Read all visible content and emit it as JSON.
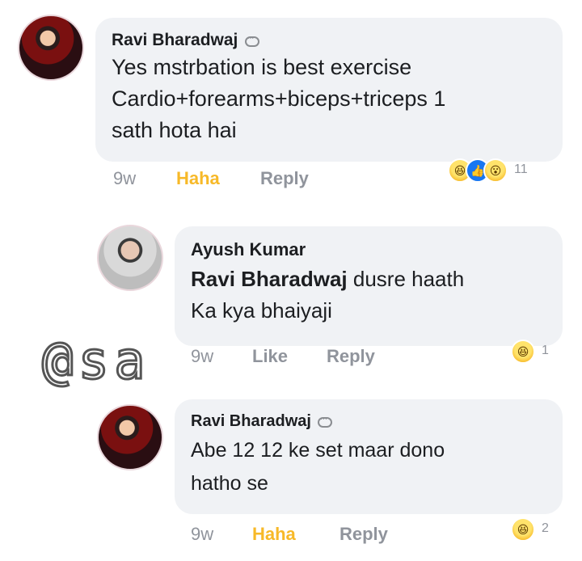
{
  "comments": [
    {
      "author": "Ravi Bharadwaj",
      "lines": [
        "Yes mstrbation is best exercise",
        "Cardio+forearms+biceps+triceps 1",
        "sath hota hai"
      ],
      "time": "9w",
      "reaction_label": "Haha",
      "reply_label": "Reply",
      "reaction_count": "11"
    },
    {
      "author": "Ayush Kumar",
      "mention": "Ravi Bharadwaj",
      "line1_rest": " dusre haath",
      "line2": "Ka kya bhaiyaji",
      "time": "9w",
      "reaction_label": "Like",
      "reply_label": "Reply",
      "reaction_count": "1"
    },
    {
      "author": "Ravi Bharadwaj",
      "lines": [
        "Abe 12 12 ke set maar dono",
        "hatho se"
      ],
      "time": "9w",
      "reaction_label": "Haha",
      "reply_label": "Reply",
      "reaction_count": "2"
    }
  ],
  "watermark": "@sa",
  "icons": {
    "messenger": "messenger-icon",
    "haha": "haha-emoji-icon",
    "like": "like-emoji-icon",
    "wow": "wow-emoji-icon"
  },
  "colors": {
    "bubble": "#f0f2f5",
    "haha": "#f7b928",
    "like": "#1877f2",
    "meta": "#90949c"
  }
}
